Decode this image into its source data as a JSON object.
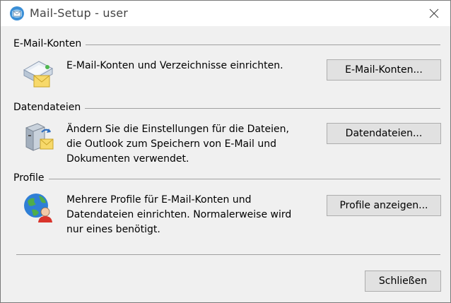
{
  "window": {
    "title": "Mail-Setup - user",
    "close_icon": "close-icon"
  },
  "sections": [
    {
      "label": "E-Mail-Konten",
      "icon": "email-accounts-icon",
      "description": "E-Mail-Konten und Verzeichnisse einrichten.",
      "button": "E-Mail-Konten..."
    },
    {
      "label": "Datendateien",
      "icon": "data-files-icon",
      "description_lines": [
        "Ändern Sie die Einstellungen für die Dateien,",
        "die Outlook zum Speichern von E-Mail und",
        "Dokumenten verwendet."
      ],
      "button": "Datendateien..."
    },
    {
      "label": "Profile",
      "icon": "profiles-icon",
      "description_lines": [
        "Mehrere Profile für E-Mail-Konten und",
        "Datendateien einrichten. Normalerweise wird",
        "nur eines benötigt."
      ],
      "button": "Profile anzeigen..."
    }
  ],
  "footer": {
    "close_button": "Schließen"
  }
}
